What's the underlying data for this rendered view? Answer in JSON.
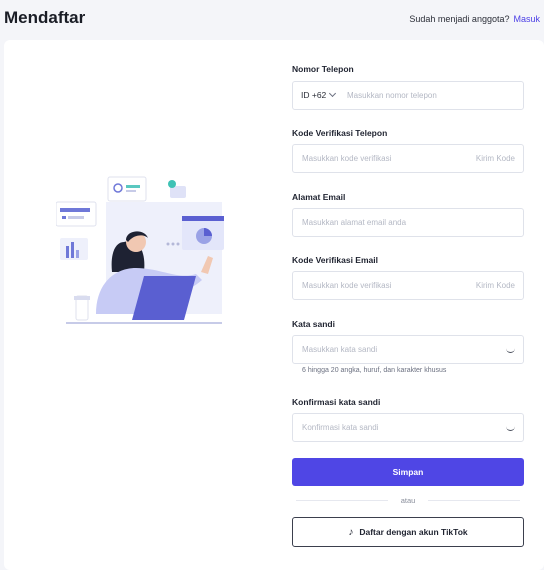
{
  "header": {
    "title": "Mendaftar",
    "login_prompt": "Sudah menjadi anggota?",
    "login_link": "Masuk"
  },
  "form": {
    "phone": {
      "label": "Nomor Telepon",
      "country_code": "ID +62",
      "placeholder": "Masukkan nomor telepon"
    },
    "phone_code": {
      "label": "Kode Verifikasi Telepon",
      "placeholder": "Masukkan kode verifikasi",
      "action": "Kirim Kode"
    },
    "email": {
      "label": "Alamat Email",
      "placeholder": "Masukkan alamat email anda"
    },
    "email_code": {
      "label": "Kode Verifikasi Email",
      "placeholder": "Masukkan kode verifikasi",
      "action": "Kirim Kode"
    },
    "password": {
      "label": "Kata sandi",
      "placeholder": "Masukkan kata sandi",
      "hint": "6 hingga 20 angka, huruf, dan karakter khusus"
    },
    "confirm_password": {
      "label": "Konfirmasi kata sandi",
      "placeholder": "Konfirmasi kata sandi"
    },
    "submit_label": "Simpan",
    "divider_text": "atau",
    "tiktok_label": "Daftar dengan akun TikTok"
  },
  "colors": {
    "primary": "#4f46e5",
    "background": "#f4f5f9",
    "card": "#ffffff"
  }
}
